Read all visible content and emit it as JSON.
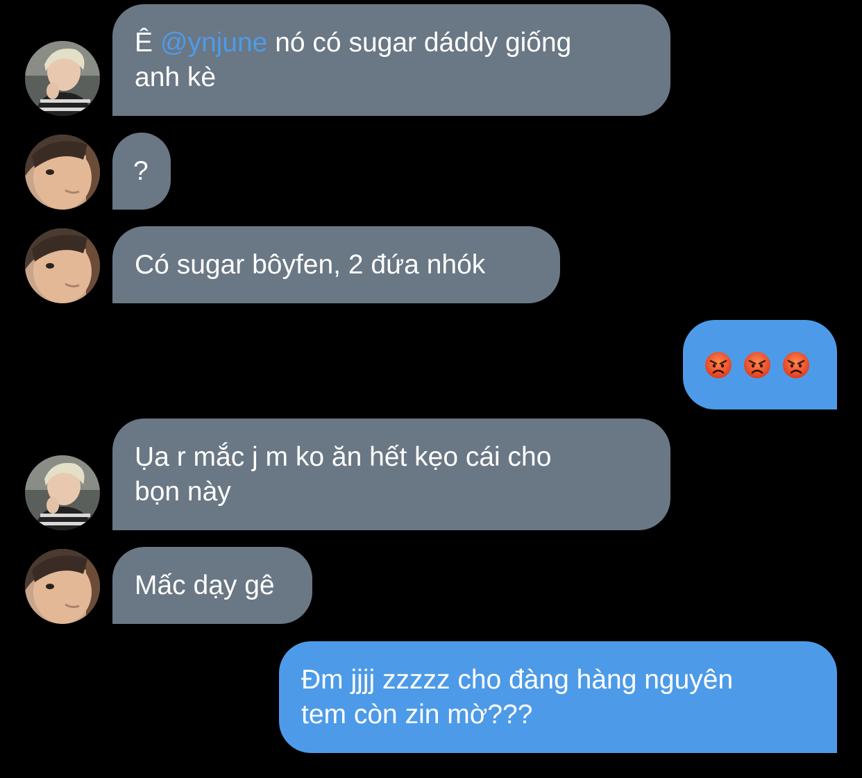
{
  "colors": {
    "background": "#000000",
    "incoming_bubble": "#6a7784",
    "outgoing_bubble": "#4d9be8",
    "mention": "#4d9be8"
  },
  "messages": [
    {
      "direction": "incoming",
      "avatar": "avatar-blond-user",
      "prefix": "Ê ",
      "mention": "@ynjune",
      "line1_rest": " nó có sugar dáddy giống",
      "line2": "anh kè"
    },
    {
      "direction": "incoming",
      "avatar": "avatar-dark-hair-user",
      "text": "?"
    },
    {
      "direction": "incoming",
      "avatar": "avatar-dark-hair-user",
      "text": "Có sugar bôyfen, 2 đứa nhók"
    },
    {
      "direction": "outgoing",
      "emojis": [
        "angry-face-emoji",
        "angry-face-emoji",
        "angry-face-emoji"
      ]
    },
    {
      "direction": "incoming",
      "avatar": "avatar-blond-user",
      "line1": "Ụa r mắc j m ko ăn hết kẹo cái cho",
      "line2": "bọn này"
    },
    {
      "direction": "incoming",
      "avatar": "avatar-dark-hair-user",
      "text": "Mấc dạy gê"
    },
    {
      "direction": "outgoing",
      "line1": "Đm jjjj zzzzz cho đàng hàng nguyên",
      "line2": "tem còn zin mờ???"
    }
  ]
}
